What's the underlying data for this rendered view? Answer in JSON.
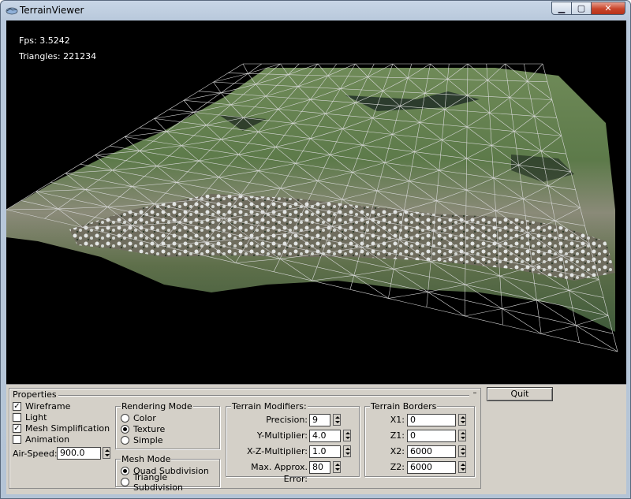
{
  "window": {
    "title": "TerrainViewer"
  },
  "hud": {
    "fps": "Fps: 3.5242",
    "triangles": "Triangles: 221234"
  },
  "properties": {
    "title": "Properties",
    "collapse": "–",
    "wireframe": {
      "label": "Wireframe",
      "checked": true
    },
    "light": {
      "label": "Light",
      "checked": false
    },
    "mesh_simplification": {
      "label": "Mesh Simplification",
      "checked": true
    },
    "animation": {
      "label": "Animation",
      "checked": false
    },
    "air_speed": {
      "label": "Air-Speed:",
      "value": "900.0"
    },
    "rendering_mode": {
      "title": "Rendering Mode",
      "options": [
        "Color",
        "Texture",
        "Simple"
      ],
      "selected": "Texture"
    },
    "mesh_mode": {
      "title": "Mesh Mode",
      "options": [
        "Quad Subdivision",
        "Triangle Subdivision"
      ],
      "selected": "Quad Subdivision"
    },
    "terrain_modifiers": {
      "title": "Terrain Modifiers:",
      "precision": {
        "label": "Precision:",
        "value": "9"
      },
      "y_multiplier": {
        "label": "Y-Multiplier:",
        "value": "4.0"
      },
      "xz_multiplier": {
        "label": "X-Z-Multiplier:",
        "value": "1.0"
      },
      "max_error": {
        "label": "Max. Approx. Error:",
        "value": "80"
      }
    },
    "terrain_borders": {
      "title": "Terrain Borders",
      "x1": {
        "label": "X1:",
        "value": "0"
      },
      "z1": {
        "label": "Z1:",
        "value": "0"
      },
      "x2": {
        "label": "X2:",
        "value": "6000"
      },
      "z2": {
        "label": "Z2:",
        "value": "6000"
      }
    }
  },
  "quit_label": "Quit",
  "colors": {
    "viewport": "#000000",
    "panel": "#d4d0c8",
    "wire": "#e8e8e8"
  }
}
